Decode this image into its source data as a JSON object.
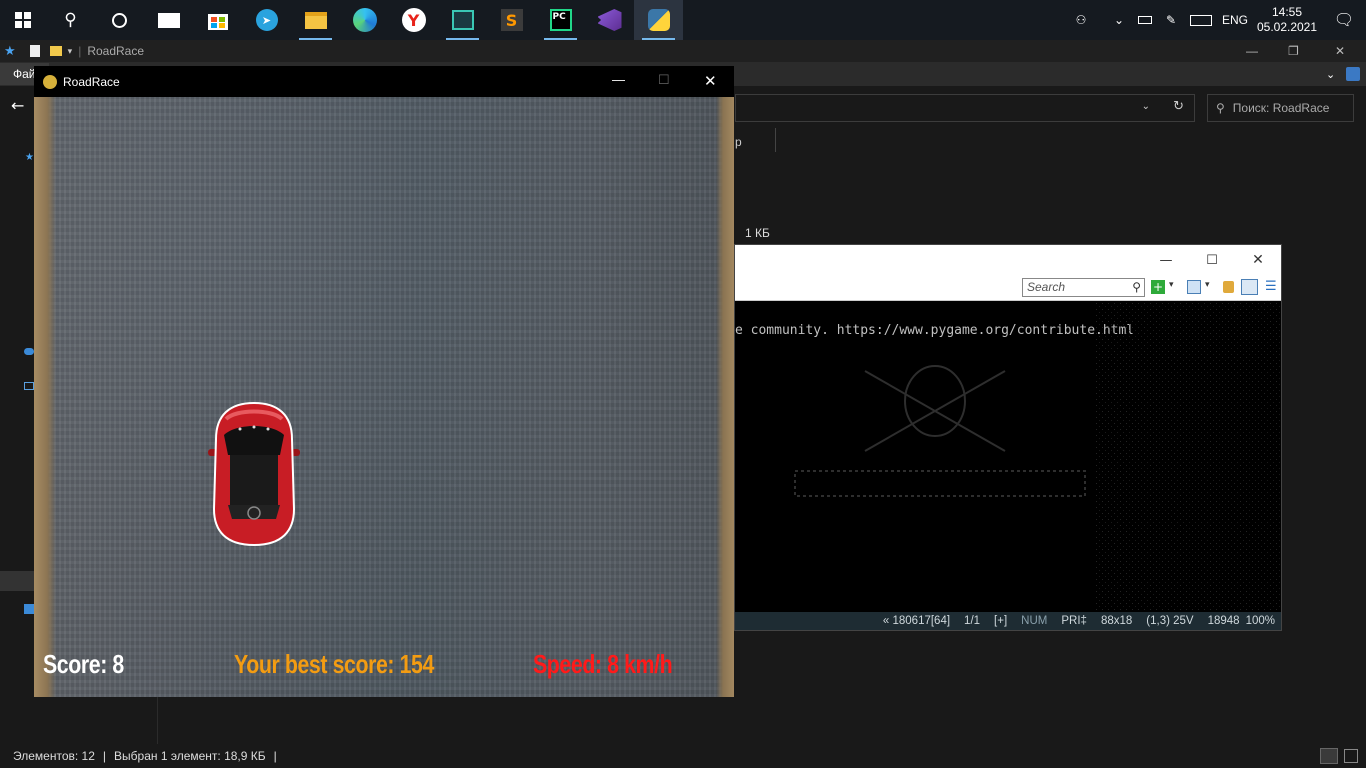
{
  "taskbar": {
    "apps": [
      {
        "icon": "windows-start-icon"
      },
      {
        "icon": "search-icon"
      },
      {
        "icon": "task-view-icon"
      },
      {
        "icon": "mail-icon"
      },
      {
        "icon": "store-icon"
      },
      {
        "icon": "telegram-icon"
      },
      {
        "icon": "file-explorer-icon"
      },
      {
        "icon": "edge-icon"
      },
      {
        "icon": "yandex-icon"
      },
      {
        "icon": "terminal-icon"
      },
      {
        "icon": "sublime-icon"
      },
      {
        "icon": "pycharm-icon"
      },
      {
        "icon": "visual-studio-icon"
      },
      {
        "icon": "python-icon"
      }
    ],
    "lang": "ENG",
    "time": "14:55",
    "date": "05.02.2021"
  },
  "explorer": {
    "title": "RoadRace",
    "tab_label": "Фай",
    "search_placeholder": "Поиск: RoadRace",
    "column_fragment": "р",
    "file_size": "1 КБ",
    "status": {
      "items_count": "Элементов: 12",
      "selected": "Выбран 1 элемент: 18,9 КБ"
    }
  },
  "console": {
    "search_placeholder": "Search",
    "line1": "e community. https://www.pygame.org/contribute.html",
    "status": {
      "pos": "« 180617[64]",
      "page": "1/1",
      "mod": "[+]",
      "num": "NUM",
      "pri": "PRI‡",
      "size": "88x18",
      "cursor": "(1,3) 25V",
      "mem": "18948",
      "zoom": "100%"
    }
  },
  "game": {
    "title": "RoadRace",
    "hud": {
      "score": "Score: 8",
      "best": "Your best score: 154",
      "speed": "Speed: 8 km/h"
    },
    "colors": {
      "score": "#ffffff",
      "best": "#f39c12",
      "speed": "#ff1a1a",
      "car": "#c81d25"
    }
  }
}
